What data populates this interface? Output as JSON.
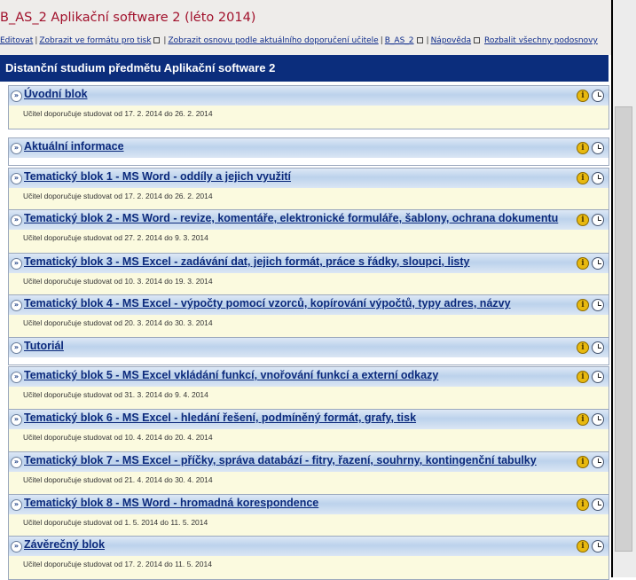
{
  "header": {
    "course_title": "B_AS_2 Aplikační software 2 (léto 2014)"
  },
  "toolbar": {
    "edit": "Editovat",
    "print_view": "Zobrazit ve formátu pro tisk",
    "outline_view": "Zobrazit osnovu podle aktuálního doporučení učitele",
    "course_code": "B_AS_2",
    "help": "Nápověda",
    "expand_all": "Rozbalit všechny podosnovy"
  },
  "banner": {
    "title": "Distanční studium předmětu Aplikační software 2"
  },
  "blocks": [
    {
      "title": "Úvodní blok",
      "recommend": "Učitel doporučuje studovat od 17. 2. 2014 do 26. 2. 2014"
    },
    {
      "title": "Aktuální informace",
      "recommend": ""
    },
    {
      "title": "Tematický blok 1 - MS Word - oddíly a jejich využití",
      "recommend": "Učitel doporučuje studovat od 17. 2. 2014 do 26. 2. 2014"
    },
    {
      "title": "Tematický blok 2 - MS Word - revize, komentáře, elektronické formuláře, šablony, ochrana dokumentu",
      "recommend": "Učitel doporučuje studovat od 27. 2. 2014 do 9. 3. 2014"
    },
    {
      "title": "Tematický blok 3 - MS Excel - zadávání dat, jejich formát, práce s řádky, sloupci, listy",
      "recommend": "Učitel doporučuje studovat od 10. 3. 2014 do 19. 3. 2014"
    },
    {
      "title": "Tematický blok 4 - MS Excel - výpočty pomocí vzorců, kopírování výpočtů, typy adres, názvy",
      "recommend": "Učitel doporučuje studovat od 20. 3. 2014 do 30. 3. 2014"
    },
    {
      "title": "Tutoriál",
      "recommend": ""
    },
    {
      "title": "Tematický blok 5 - MS Excel vkládání funkcí, vnořování funkcí a externí odkazy",
      "recommend": "Učitel doporučuje studovat od 31. 3. 2014 do 9. 4. 2014"
    },
    {
      "title": "Tematický blok 6 - MS Excel - hledání řešení, podmíněný formát, grafy, tisk",
      "recommend": "Učitel doporučuje studovat od 10. 4. 2014 do 20. 4. 2014"
    },
    {
      "title": "Tematický blok 7 - MS Excel - příčky, správa databází - fitry, řazení, souhrny, kontingenční tabulky",
      "recommend": "Učitel doporučuje studovat od 21. 4. 2014 do 30. 4. 2014"
    },
    {
      "title": "Tematický blok 8 - MS Word - hromadná korespondence",
      "recommend": "Učitel doporučuje studovat od 1. 5. 2014 do 11. 5. 2014"
    },
    {
      "title": "Závěrečný blok",
      "recommend": "Učitel doporučuje studovat od 17. 2. 2014 do 11. 5. 2014"
    }
  ],
  "icons": {
    "expand": "»",
    "info": "i"
  }
}
